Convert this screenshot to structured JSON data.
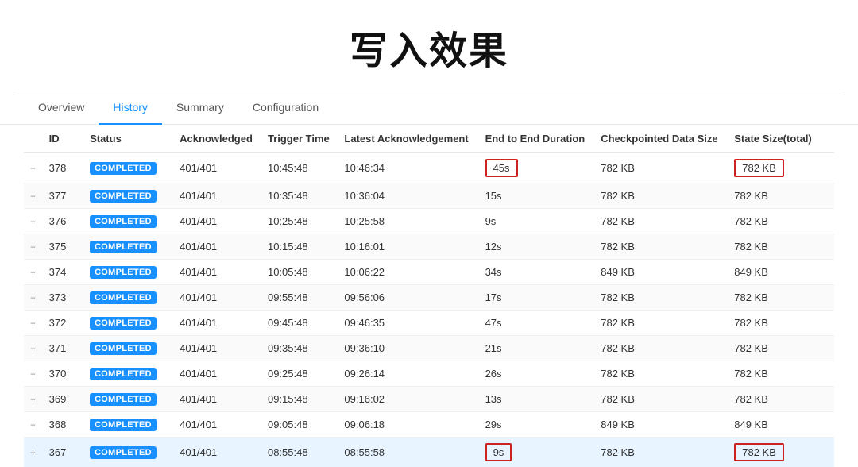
{
  "title": "写入效果",
  "tabs": [
    {
      "label": "Overview",
      "active": false
    },
    {
      "label": "History",
      "active": true
    },
    {
      "label": "Summary",
      "active": false
    },
    {
      "label": "Configuration",
      "active": false
    }
  ],
  "columns": [
    {
      "key": "expand",
      "label": ""
    },
    {
      "key": "id",
      "label": "ID"
    },
    {
      "key": "status",
      "label": "Status"
    },
    {
      "key": "acknowledged",
      "label": "Acknowledged"
    },
    {
      "key": "trigger_time",
      "label": "Trigger Time"
    },
    {
      "key": "latest_ack",
      "label": "Latest Acknowledgement"
    },
    {
      "key": "e2e_duration",
      "label": "End to End Duration"
    },
    {
      "key": "checkpoint_size",
      "label": "Checkpointed Data Size"
    },
    {
      "key": "state_size",
      "label": "State Size(total)"
    }
  ],
  "rows": [
    {
      "id": "378",
      "status": "COMPLETED",
      "acknowledged": "401/401",
      "trigger_time": "10:45:48",
      "latest_ack": "10:46:34",
      "e2e_duration": "45s",
      "checkpoint_size": "782 KB",
      "state_size": "782 KB",
      "highlight": true
    },
    {
      "id": "377",
      "status": "COMPLETED",
      "acknowledged": "401/401",
      "trigger_time": "10:35:48",
      "latest_ack": "10:36:04",
      "e2e_duration": "15s",
      "checkpoint_size": "782 KB",
      "state_size": "782 KB",
      "highlight": false
    },
    {
      "id": "376",
      "status": "COMPLETED",
      "acknowledged": "401/401",
      "trigger_time": "10:25:48",
      "latest_ack": "10:25:58",
      "e2e_duration": "9s",
      "checkpoint_size": "782 KB",
      "state_size": "782 KB",
      "highlight": false
    },
    {
      "id": "375",
      "status": "COMPLETED",
      "acknowledged": "401/401",
      "trigger_time": "10:15:48",
      "latest_ack": "10:16:01",
      "e2e_duration": "12s",
      "checkpoint_size": "782 KB",
      "state_size": "782 KB",
      "highlight": false
    },
    {
      "id": "374",
      "status": "COMPLETED",
      "acknowledged": "401/401",
      "trigger_time": "10:05:48",
      "latest_ack": "10:06:22",
      "e2e_duration": "34s",
      "checkpoint_size": "849 KB",
      "state_size": "849 KB",
      "highlight": false
    },
    {
      "id": "373",
      "status": "COMPLETED",
      "acknowledged": "401/401",
      "trigger_time": "09:55:48",
      "latest_ack": "09:56:06",
      "e2e_duration": "17s",
      "checkpoint_size": "782 KB",
      "state_size": "782 KB",
      "highlight": false
    },
    {
      "id": "372",
      "status": "COMPLETED",
      "acknowledged": "401/401",
      "trigger_time": "09:45:48",
      "latest_ack": "09:46:35",
      "e2e_duration": "47s",
      "checkpoint_size": "782 KB",
      "state_size": "782 KB",
      "highlight": false
    },
    {
      "id": "371",
      "status": "COMPLETED",
      "acknowledged": "401/401",
      "trigger_time": "09:35:48",
      "latest_ack": "09:36:10",
      "e2e_duration": "21s",
      "checkpoint_size": "782 KB",
      "state_size": "782 KB",
      "highlight": false
    },
    {
      "id": "370",
      "status": "COMPLETED",
      "acknowledged": "401/401",
      "trigger_time": "09:25:48",
      "latest_ack": "09:26:14",
      "e2e_duration": "26s",
      "checkpoint_size": "782 KB",
      "state_size": "782 KB",
      "highlight": false
    },
    {
      "id": "369",
      "status": "COMPLETED",
      "acknowledged": "401/401",
      "trigger_time": "09:15:48",
      "latest_ack": "09:16:02",
      "e2e_duration": "13s",
      "checkpoint_size": "782 KB",
      "state_size": "782 KB",
      "highlight": false
    },
    {
      "id": "368",
      "status": "COMPLETED",
      "acknowledged": "401/401",
      "trigger_time": "09:05:48",
      "latest_ack": "09:06:18",
      "e2e_duration": "29s",
      "checkpoint_size": "849 KB",
      "state_size": "849 KB",
      "highlight": false
    },
    {
      "id": "367",
      "status": "COMPLETED",
      "acknowledged": "401/401",
      "trigger_time": "08:55:48",
      "latest_ack": "08:55:58",
      "e2e_duration": "9s",
      "checkpoint_size": "782 KB",
      "state_size": "782 KB",
      "highlight": true,
      "last_row": true
    }
  ]
}
